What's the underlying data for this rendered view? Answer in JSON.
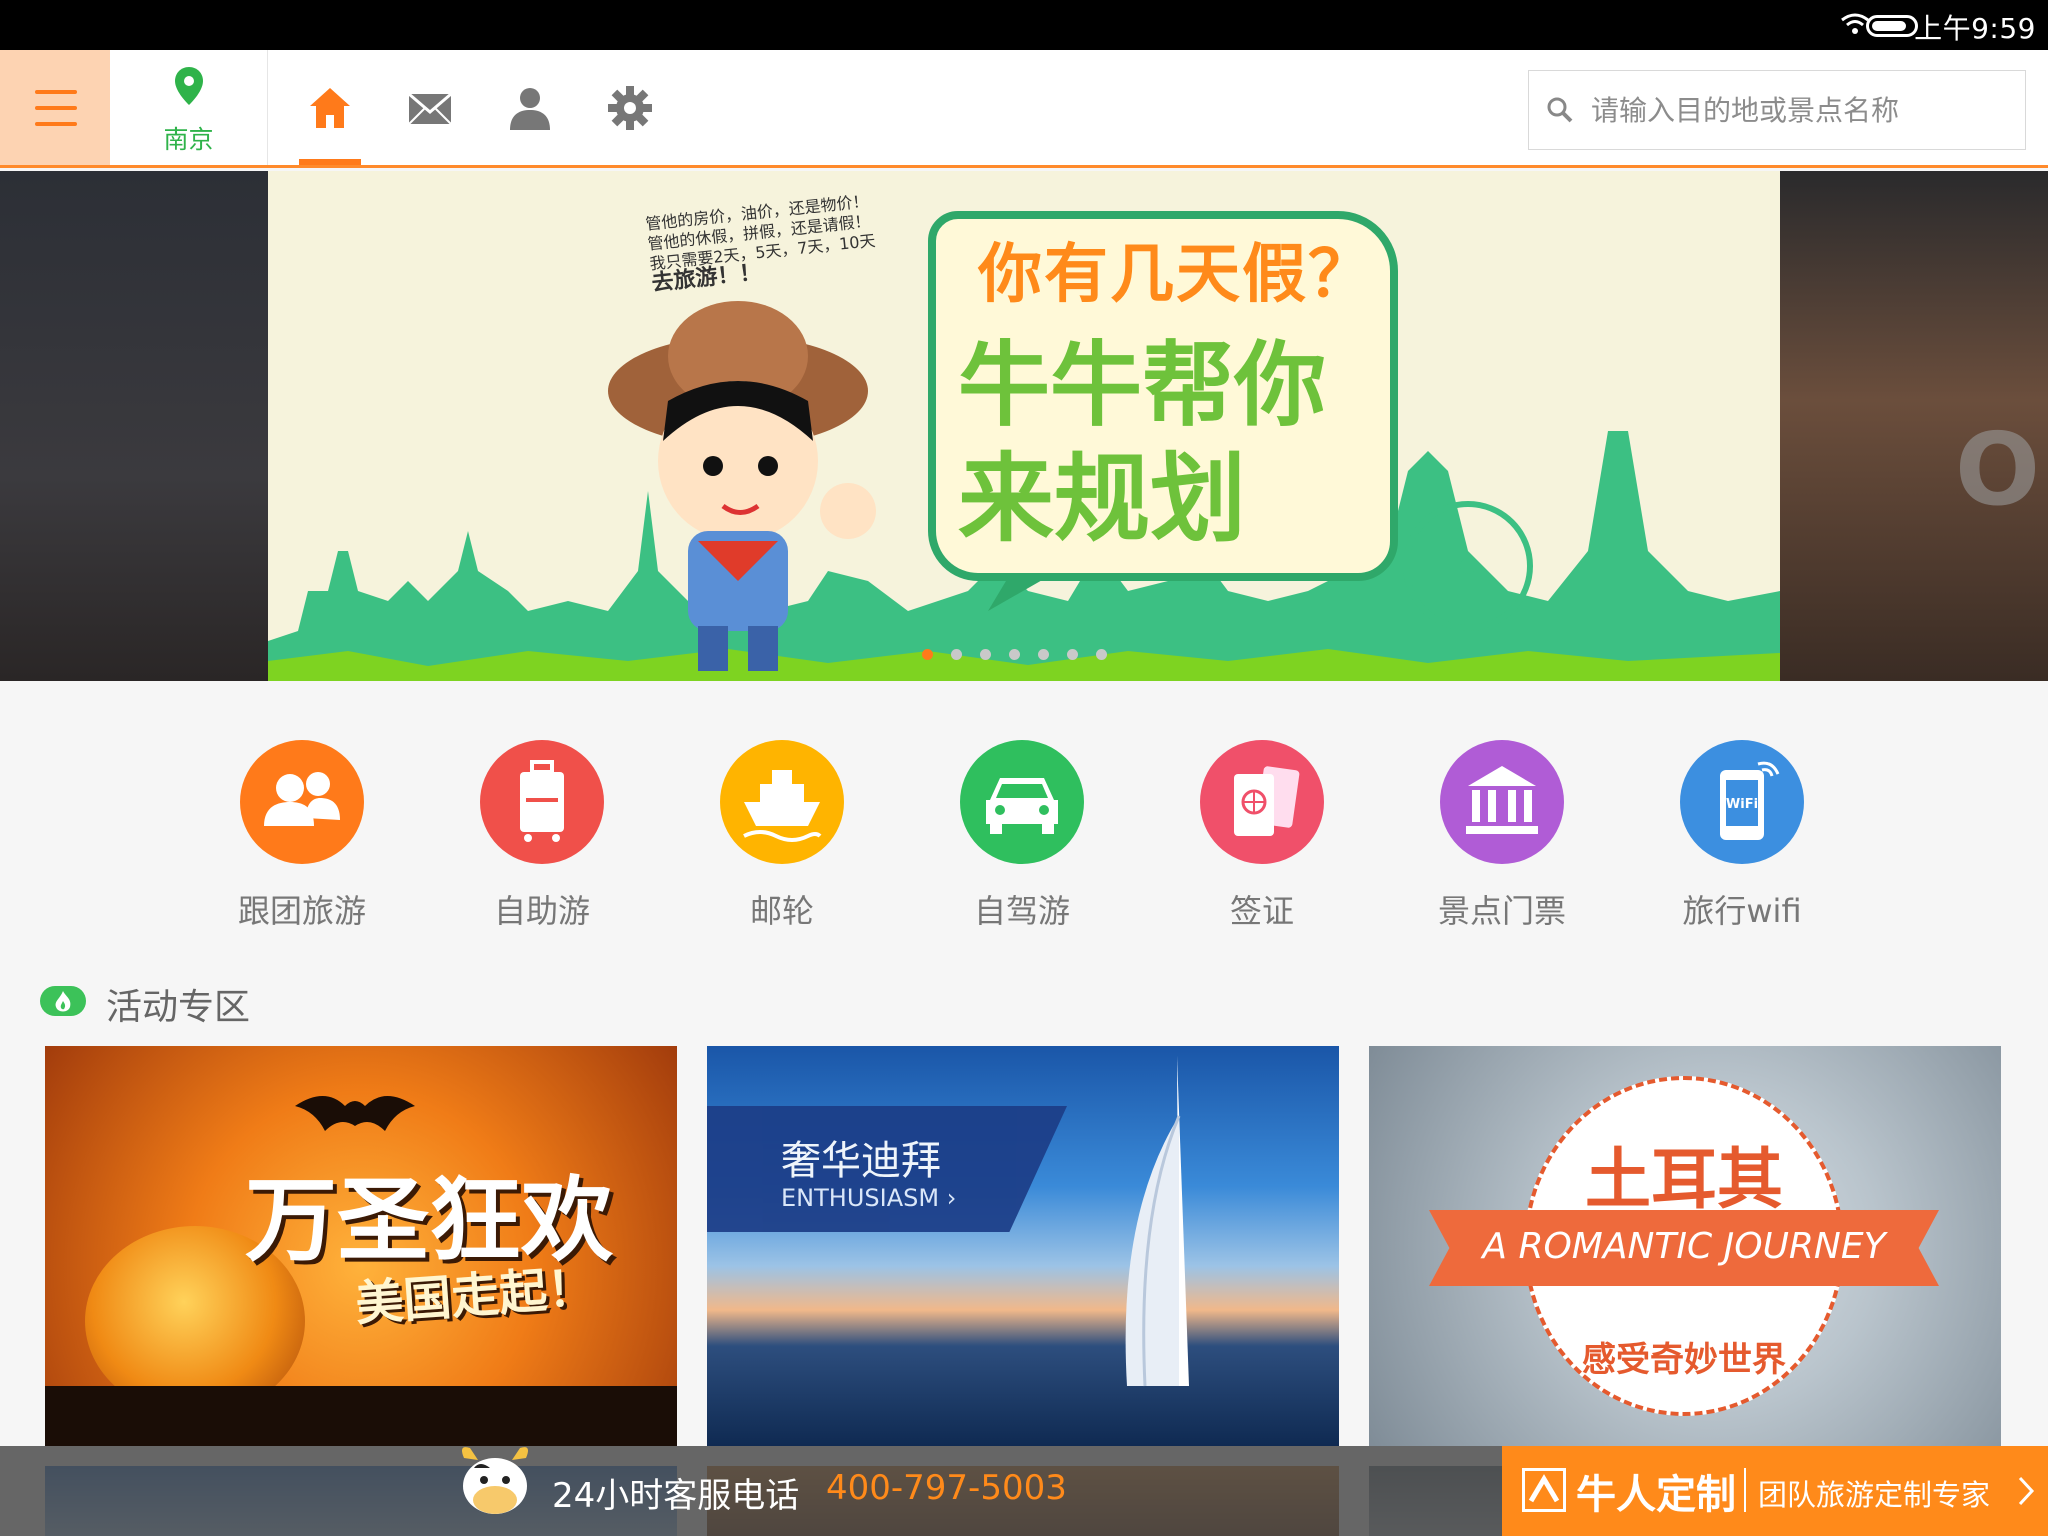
{
  "status_bar": {
    "time": "上午9:59"
  },
  "header": {
    "city": "南京",
    "search_placeholder": "请输入目的地或景点名称",
    "nav": [
      "home-icon",
      "mail-icon",
      "user-icon",
      "gear-icon"
    ]
  },
  "banner": {
    "small_text_1": "管他的房价，油价，还是物价！",
    "small_text_2": "管他的休假，拼假，还是请假！",
    "small_text_3": "我只需要2天，5天，7天，10天",
    "small_text_4": "去旅游！！",
    "headline": "你有几天假？",
    "sub1": "牛牛帮你",
    "sub2": "来规划",
    "dots_total": 7,
    "dots_active": 1
  },
  "categories": [
    {
      "label": "跟团旅游",
      "color": "#ff7a1a",
      "icon": "group-icon"
    },
    {
      "label": "自助游",
      "color": "#f0504a",
      "icon": "luggage-icon"
    },
    {
      "label": "邮轮",
      "color": "#ffb400",
      "icon": "ship-icon"
    },
    {
      "label": "自驾游",
      "color": "#2fbf5e",
      "icon": "car-icon"
    },
    {
      "label": "签证",
      "color": "#f0506a",
      "icon": "passport-icon"
    },
    {
      "label": "景点门票",
      "color": "#b05cd6",
      "icon": "museum-icon"
    },
    {
      "label": "旅行wifi",
      "color": "#3c8fe0",
      "icon": "wifi-phone-icon"
    }
  ],
  "section": {
    "title": "活动专区"
  },
  "cards": {
    "halloween": {
      "title": "万圣狂欢",
      "subtitle": "美国走起！"
    },
    "dubai": {
      "title": "奢华迪拜",
      "subtitle": "ENTHUSIASM"
    },
    "turkey": {
      "title": "土耳其",
      "banner": "A ROMANTIC JOURNEY",
      "subtitle": "感受奇妙世界"
    }
  },
  "bottom_bar": {
    "service_label": "24小时客服电话",
    "phone": "400-797-5003",
    "custom_name": "牛人定制",
    "custom_slogan": "团队旅游定制专家"
  },
  "colors": {
    "accent": "#ff7a1a",
    "green": "#2fb34a"
  }
}
